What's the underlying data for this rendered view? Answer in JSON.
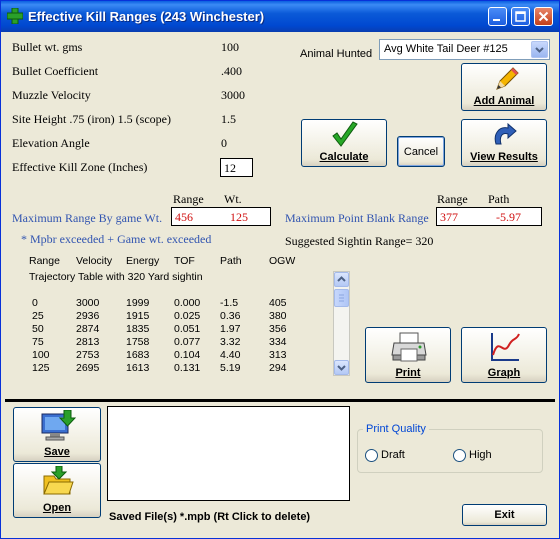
{
  "title": "Effective Kill Ranges  (243 Winchester)",
  "inputs": [
    {
      "label": "Bullet wt. gms",
      "value": "100"
    },
    {
      "label": "Bullet Coefficient",
      "value": ".400"
    },
    {
      "label": "Muzzle Velocity",
      "value": "3000"
    },
    {
      "label": "Site Height .75 (iron) 1.5 (scope)",
      "value": "1.5"
    },
    {
      "label": "Elevation Angle",
      "value": "0"
    },
    {
      "label": "Effective Kill Zone (Inches)",
      "value": "12"
    }
  ],
  "animal": {
    "label": "Animal Hunted",
    "selected": "Avg White Tail Deer #125"
  },
  "buttons": {
    "add_animal": "Add Animal",
    "calculate": "Calculate",
    "cancel": "Cancel",
    "view_results": "View Results",
    "print": "Print",
    "graph": "Graph",
    "save": "Save",
    "open": "Open",
    "exit": "Exit"
  },
  "max_range": {
    "label": "Maximum Range By game Wt.",
    "col_range": "Range",
    "col_wt": "Wt.",
    "range": "456",
    "wt": "125"
  },
  "pbr": {
    "label": "Maximum Point Blank Range",
    "col_range": "Range",
    "col_path": "Path",
    "range": "377",
    "path": "-5.97"
  },
  "notes": {
    "exceeded": "*  Mpbr exceeded +  Game wt. exceeded",
    "sightin": "Suggested Sightin Range= 320"
  },
  "table": {
    "headers": [
      "Range",
      "Velocity",
      "Energy",
      "TOF",
      "Path",
      "OGW"
    ],
    "caption": "Trajectory Table with 320 Yard sightin",
    "rows": [
      [
        "0",
        "3000",
        "1999",
        "0.000",
        "-1.5",
        "405"
      ],
      [
        "25",
        "2936",
        "1915",
        "0.025",
        "0.36",
        "380"
      ],
      [
        "50",
        "2874",
        "1835",
        "0.051",
        "1.97",
        "356"
      ],
      [
        "75",
        "2813",
        "1758",
        "0.077",
        "3.32",
        "334"
      ],
      [
        "100",
        "2753",
        "1683",
        "0.104",
        "4.40",
        "313"
      ],
      [
        "125",
        "2695",
        "1613",
        "0.131",
        "5.19",
        "294"
      ]
    ]
  },
  "saved_files_label": "Saved File(s) *.mpb (Rt Click to delete)",
  "print_quality": {
    "label": "Print Quality",
    "draft": "Draft",
    "high": "High"
  },
  "colors": {
    "accent": "#0046d5",
    "value_red": "#d01010",
    "label_blue": "#3154b0"
  }
}
